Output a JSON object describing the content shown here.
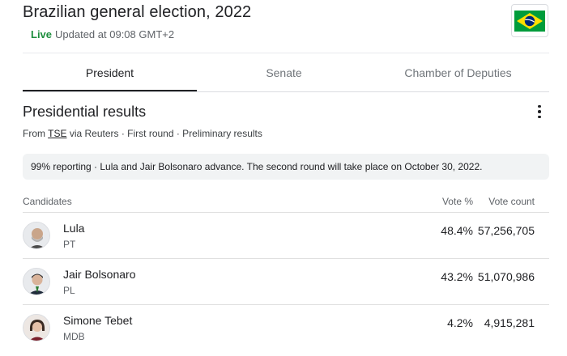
{
  "header": {
    "title": "Brazilian general election, 2022",
    "live_label": "Live",
    "updated_text": "Updated at 09:08 GMT+2",
    "flag_icon": "brazil-flag-icon"
  },
  "tabs": [
    {
      "label": "President",
      "active": true
    },
    {
      "label": "Senate",
      "active": false
    },
    {
      "label": "Chamber of Deputies",
      "active": false
    }
  ],
  "results": {
    "title": "Presidential results",
    "source_prefix": "From",
    "source_link": "TSE",
    "source_suffix": "via Reuters · First round · Preliminary results",
    "notice": "99% reporting · Lula and Jair Bolsonaro advance. The second round will take place on October 30, 2022.",
    "columns": {
      "candidates": "Candidates",
      "vote_pct": "Vote %",
      "vote_count": "Vote count"
    },
    "candidates": [
      {
        "name": "Lula",
        "party": "PT",
        "vote_pct": "48.4%",
        "vote_count": "57,256,705"
      },
      {
        "name": "Jair Bolsonaro",
        "party": "PL",
        "vote_pct": "43.2%",
        "vote_count": "51,070,986"
      },
      {
        "name": "Simone Tebet",
        "party": "MDB",
        "vote_pct": "4.2%",
        "vote_count": "4,915,281"
      }
    ]
  },
  "colors": {
    "live_green": "#1e8e3e",
    "flag_green": "#009c3b",
    "flag_yellow": "#ffdf00",
    "flag_blue": "#002776"
  }
}
